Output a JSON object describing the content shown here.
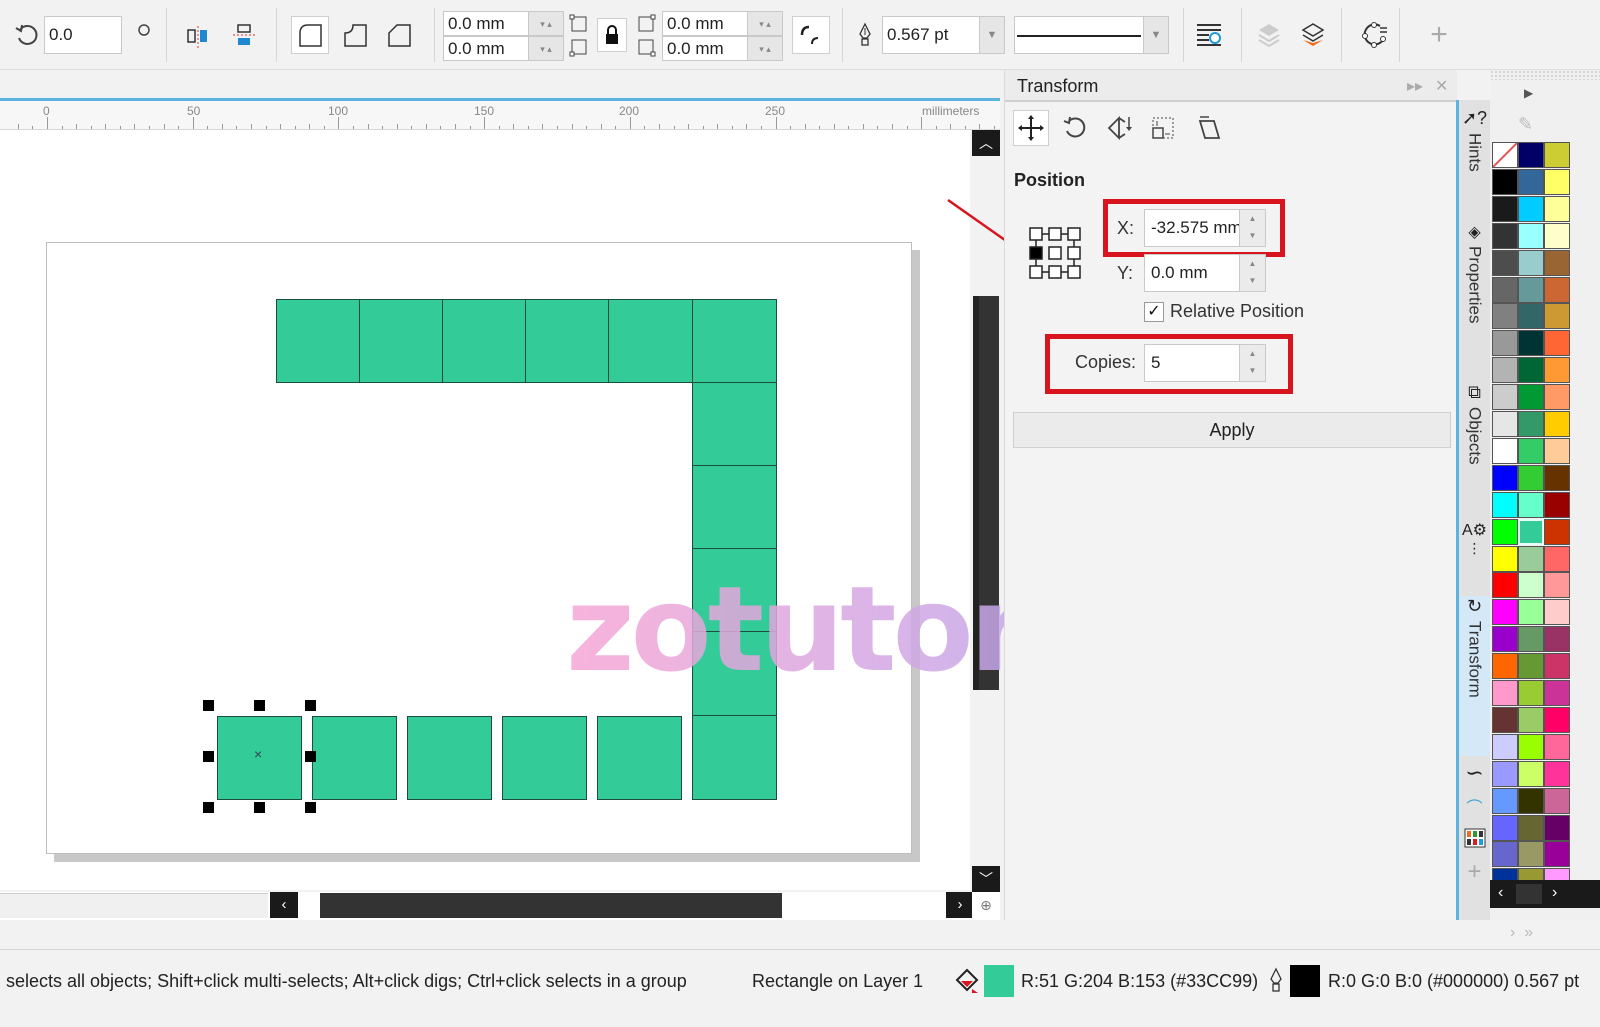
{
  "toolbar": {
    "rotation_value": "0.0",
    "corner_radius": {
      "top_left": "0.0 mm",
      "bottom_left": "0.0 mm",
      "top_right": "0.0 mm",
      "bottom_right": "0.0 mm"
    },
    "outline_width": "0.567 pt",
    "icons": [
      "rotate-icon",
      "degree-icon",
      "mirror-horizontal-icon",
      "mirror-vertical-icon",
      "round-corner-icon",
      "scalloped-corner-icon",
      "chamfered-corner-icon",
      "lock-ratio-icon",
      "relative-corner-scaling-icon",
      "pen-icon",
      "wrap-text-icon",
      "to-back-icon",
      "to-front-icon",
      "convert-to-curves-icon",
      "add-icon"
    ]
  },
  "ruler": {
    "labels": [
      "0",
      "50",
      "100",
      "150",
      "200",
      "250"
    ],
    "unit": "millimeters"
  },
  "canvas": {
    "fill_color": "#33CC99",
    "watermark": "zotutorial.com"
  },
  "docker": {
    "title": "Transform",
    "tools": [
      "position-tool",
      "rotate-tool",
      "scale-mirror-tool",
      "size-tool",
      "skew-tool"
    ],
    "section": "Position",
    "x_label": "X:",
    "x_value": "-32.575 mm",
    "y_label": "Y:",
    "y_value": "0.0 mm",
    "relative_position_label": "Relative Position",
    "relative_position_checked": true,
    "check_mark": "✓",
    "copies_label": "Copies:",
    "copies_value": "5",
    "apply_label": "Apply"
  },
  "side_tabs": [
    {
      "label": "Hints",
      "icon": "hints-icon"
    },
    {
      "label": "Properties",
      "icon": "properties-icon"
    },
    {
      "label": "Objects",
      "icon": "objects-icon"
    },
    {
      "label": "",
      "icon": "text-properties-icon"
    },
    {
      "label": "Transform",
      "icon": "transform-icon",
      "active": true
    },
    {
      "label": "",
      "icon": "curve-icon"
    },
    {
      "label": "",
      "icon": "node-icon"
    },
    {
      "label": "",
      "icon": "color-styles-icon"
    },
    {
      "label": "",
      "icon": "add-docker-icon"
    }
  ],
  "palette": {
    "columns": [
      [
        "none",
        "#000000",
        "#1a1a1a",
        "#333333",
        "#4d4d4d",
        "#666666",
        "#808080",
        "#999999",
        "#b3b3b3",
        "#cccccc",
        "#e6e6e6",
        "#ffffff",
        "#0000ff",
        "#00ffff",
        "#00ff00",
        "#ffff00",
        "#ff0000",
        "#ff00ff",
        "#9900cc",
        "#ff6600",
        "#ff99cc",
        "#663333",
        "#ccccff",
        "#9999ff",
        "#6699ff",
        "#6666ff",
        "#6666cc",
        "#003399"
      ],
      [
        "#000066",
        "#336699",
        "#00ccff",
        "#99ffff",
        "#99cccc",
        "#669999",
        "#336666",
        "#003333",
        "#006633",
        "#009933",
        "#339966",
        "#33cc66",
        "#33cc33",
        "#66ffcc",
        "#33cc99",
        "#99cc99",
        "#ccffcc",
        "#99ff99",
        "#669966",
        "#669933",
        "#99cc33",
        "#99cc66",
        "#99ff00",
        "#ccff66",
        "#333300",
        "#666633",
        "#999966",
        "#999933"
      ],
      [
        "#cccc33",
        "#ffff66",
        "#ffff99",
        "#ffffcc",
        "#996633",
        "#cc6633",
        "#cc9933",
        "#ff6633",
        "#ff9933",
        "#ff9966",
        "#ffcc00",
        "#ffcc99",
        "#663300",
        "#990000",
        "#cc3300",
        "#ff6666",
        "#ff9999",
        "#ffcccc",
        "#993366",
        "#cc3366",
        "#cc3399",
        "#ff0066",
        "#ff6699",
        "#ff3399",
        "#cc6699",
        "#660066",
        "#990099",
        "#ff99ff"
      ]
    ],
    "selected": "#33cc99"
  },
  "status": {
    "hint": "selects all objects; Shift+click multi-selects; Alt+click digs; Ctrl+click selects in a group",
    "object_info": "Rectangle on Layer 1",
    "fill_text": "R:51 G:204 B:153 (#33CC99)",
    "fill_color": "#33CC99",
    "outline_text": "R:0 G:0 B:0 (#000000)  0.567 pt",
    "outline_color": "#000000"
  }
}
